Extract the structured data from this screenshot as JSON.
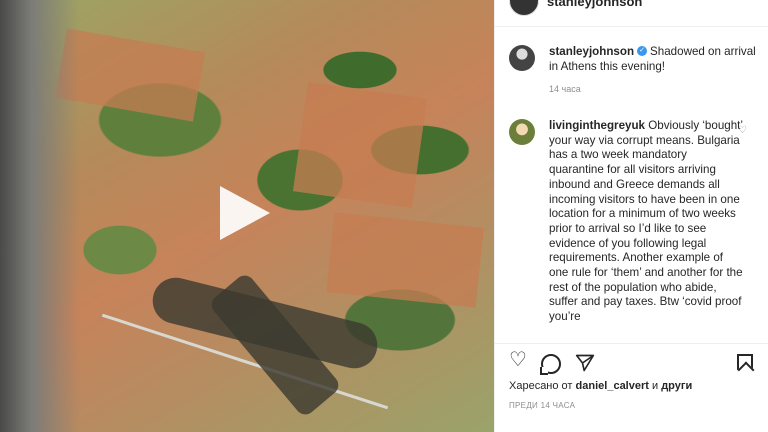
{
  "header": {
    "username": "stanleyjohnson"
  },
  "caption": {
    "username": "stanleyjohnson",
    "text": "Shadowed on arrival in Athens this evening!",
    "time": "14 часа"
  },
  "comment": {
    "username": "livinginthegreyuk",
    "text": "Obviously ‘bought’ your way via corrupt means. Bulgaria has a two week mandatory quarantine for all visitors arriving inbound and Greece demands all incoming visitors to have been in one location for a minimum of two weeks prior to arrival so I’d like to see evidence of you following legal requirements. Another example of one rule for ‘them’ and another for the rest of the population who abide, suffer and pay taxes. Btw ‘covid proof you’re"
  },
  "likes": {
    "prefix": "Харесано от",
    "user": "daniel_calvert",
    "connector": "и",
    "others": "други"
  },
  "posted": "ПРЕДИ 14 ЧАСА",
  "icons": {
    "play": "play-icon",
    "heart": "heart-icon",
    "comment": "comment-icon",
    "share": "share-icon",
    "bookmark": "bookmark-icon",
    "verified": "verified-badge-icon"
  },
  "colors": {
    "text": "#262626",
    "muted": "#8e8e8e",
    "verified": "#3897f0"
  }
}
